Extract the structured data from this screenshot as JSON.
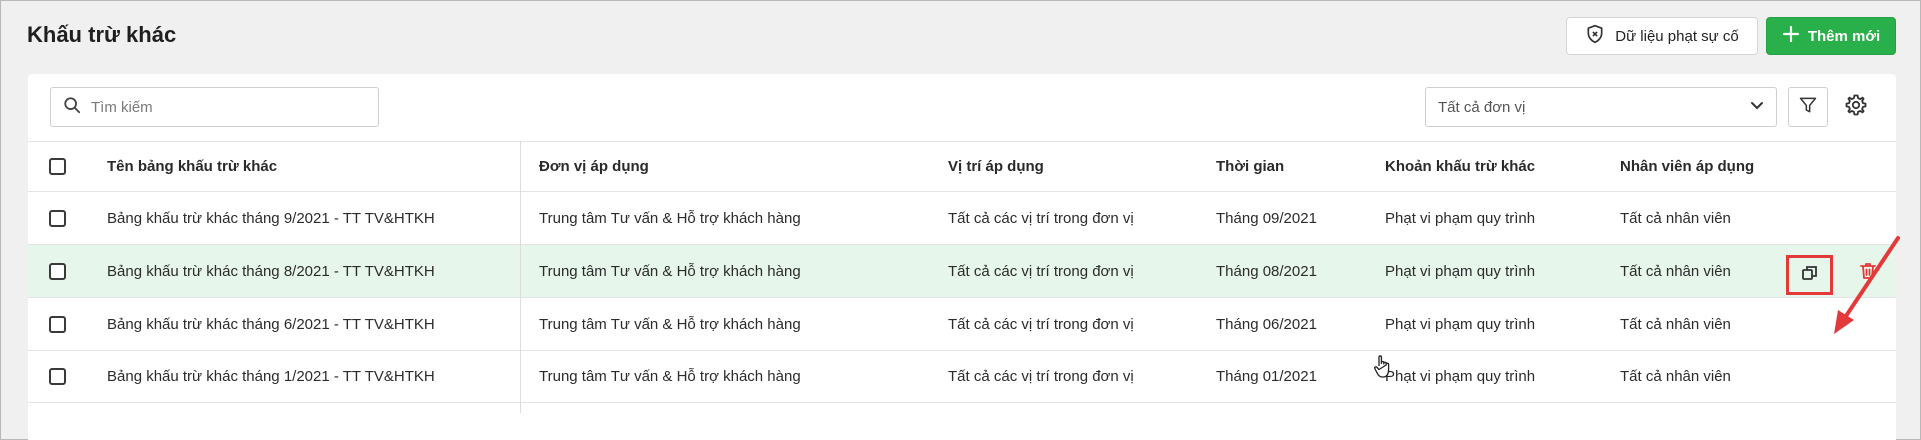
{
  "page": {
    "title": "Khấu trừ khác"
  },
  "toolbar": {
    "penalty_data_label": "Dữ liệu phạt sự cố",
    "add_new_label": "Thêm mới"
  },
  "search": {
    "placeholder": "Tìm kiếm",
    "value": ""
  },
  "unit_filter": {
    "selected": "Tất cả đơn vị"
  },
  "table": {
    "columns": [
      "Tên bảng khấu trừ khác",
      "Đơn vị áp dụng",
      "Vị trí áp dụng",
      "Thời gian",
      "Khoản khấu trừ khác",
      "Nhân viên áp dụng"
    ],
    "rows": [
      {
        "name": "Bảng khấu trừ khác tháng 9/2021 - TT TV&HTKH",
        "unit": "Trung tâm Tư vấn & Hỗ trợ khách hàng",
        "position": "Tất cả các vị trí trong đơn vị",
        "time": "Tháng 09/2021",
        "deduction": "Phạt vi phạm quy trình",
        "employees": "Tất cả nhân viên"
      },
      {
        "name": "Bảng khấu trừ khác tháng 8/2021 - TT TV&HTKH",
        "unit": "Trung tâm Tư vấn & Hỗ trợ khách hàng",
        "position": "Tất cả các vị trí trong đơn vị",
        "time": "Tháng 08/2021",
        "deduction": "Phạt vi phạm quy trình",
        "employees": "Tất cả nhân viên"
      },
      {
        "name": "Bảng khấu trừ khác tháng 6/2021 - TT TV&HTKH",
        "unit": "Trung tâm Tư vấn & Hỗ trợ khách hàng",
        "position": "Tất cả các vị trí trong đơn vị",
        "time": "Tháng 06/2021",
        "deduction": "Phạt vi phạm quy trình",
        "employees": "Tất cả nhân viên"
      },
      {
        "name": "Bảng khấu trừ khác tháng 1/2021 - TT TV&HTKH",
        "unit": "Trung tâm Tư vấn & Hỗ trợ khách hàng",
        "position": "Tất cả các vị trí trong đơn vị",
        "time": "Tháng 01/2021",
        "deduction": "Phạt vi phạm quy trình",
        "employees": "Tất cả nhân viên"
      }
    ]
  },
  "colors": {
    "primary": "#2ab04a",
    "row_hover": "#e7f6ea",
    "highlight": "#e53939",
    "delete_icon": "#e53939"
  },
  "icons": {
    "penalty_data": "shield-x-icon",
    "add": "plus-icon",
    "search": "search-icon",
    "dropdown": "chevron-down-icon",
    "filter": "filter-icon",
    "settings": "gear-icon",
    "copy": "copy-icon",
    "delete": "trash-icon"
  }
}
